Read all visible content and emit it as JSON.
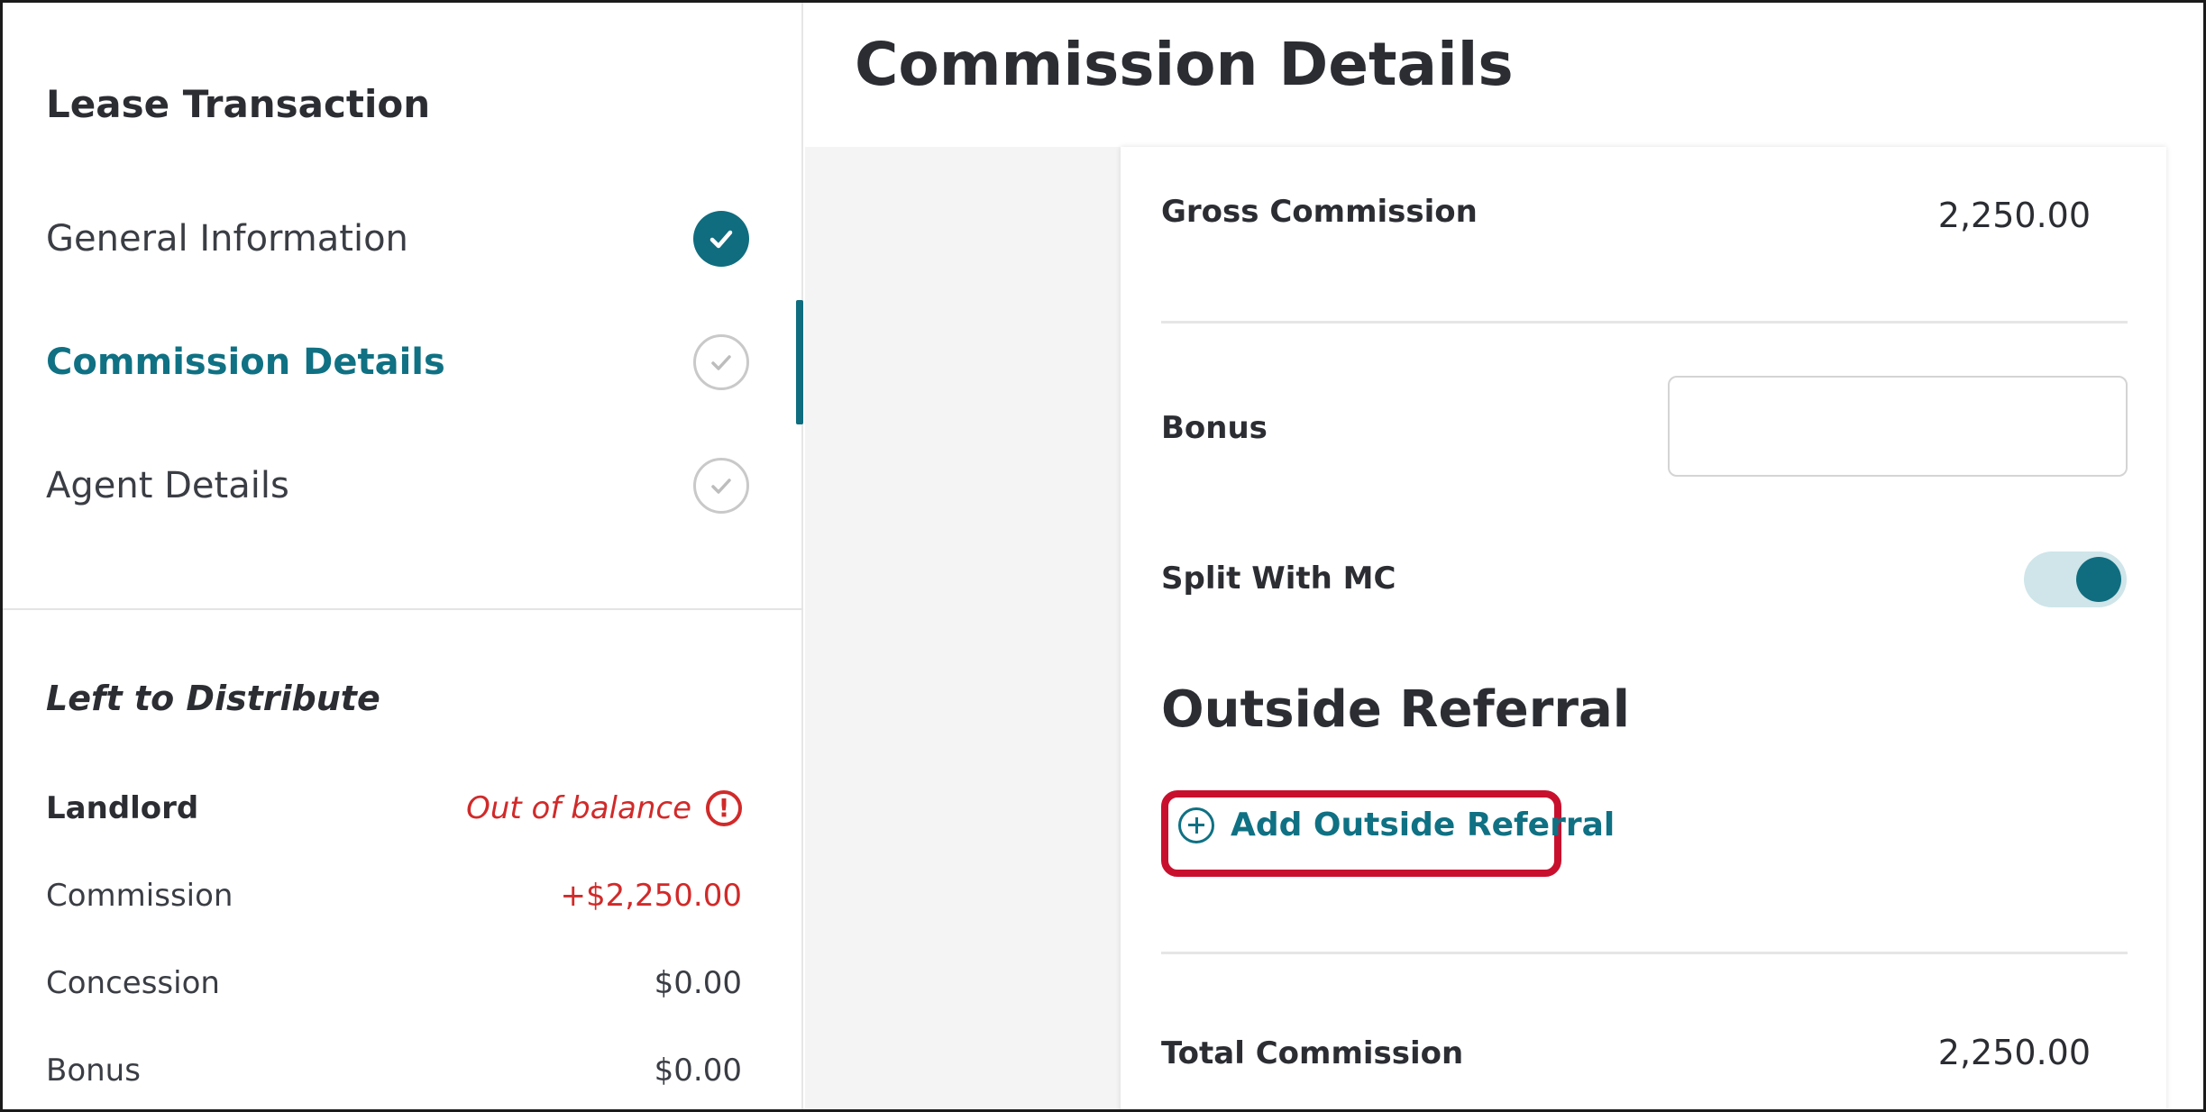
{
  "page": {
    "title": "Commission Details"
  },
  "sidebar": {
    "heading": "Lease Transaction",
    "steps": [
      {
        "label": "General Information",
        "status": "complete"
      },
      {
        "label": "Commission Details",
        "status": "active"
      },
      {
        "label": "Agent Details",
        "status": "incomplete"
      }
    ],
    "distribution": {
      "heading": "Left to Distribute",
      "party": "Landlord",
      "balance_status": "Out of balance",
      "rows": [
        {
          "label": "Commission",
          "value": "+$2,250.00",
          "color": "#d12a2a"
        },
        {
          "label": "Concession",
          "value": "$0.00"
        },
        {
          "label": "Bonus",
          "value": "$0.00"
        }
      ]
    }
  },
  "form": {
    "gross_commission": {
      "label": "Gross Commission",
      "value": "2,250.00"
    },
    "bonus": {
      "label": "Bonus",
      "value": "",
      "placeholder": ""
    },
    "split_with_mc": {
      "label": "Split With MC",
      "enabled": true
    },
    "outside_referral": {
      "title": "Outside Referral",
      "add_label": "Add Outside Referral"
    },
    "total_commission": {
      "label": "Total Commission",
      "value": "2,250.00"
    }
  },
  "colors": {
    "accent": "#0f6d7f",
    "error": "#d12a2a",
    "highlight": "#c8102e"
  },
  "icons": {
    "complete": "check-circle-filled-icon",
    "incomplete": "check-circle-outline-icon",
    "alert": "exclamation-circle-icon",
    "add": "plus-circle-icon"
  }
}
